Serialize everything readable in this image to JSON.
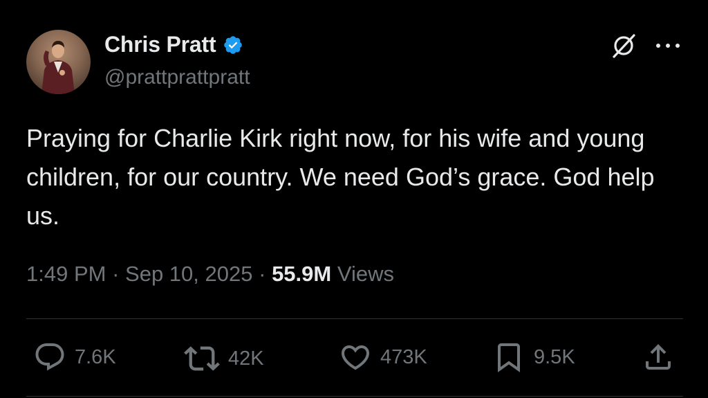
{
  "author": {
    "display_name": "Chris Pratt",
    "handle": "@prattprattpratt",
    "verified": true,
    "avatar_icon": "avatar"
  },
  "header_icons": {
    "grok": "grok-icon",
    "more": "more-icon"
  },
  "tweet": {
    "text": "Praying for Charlie Kirk right now, for his wife and young children, for our country. We need God’s grace. God help us.",
    "time": "1:49 PM",
    "separator": "·",
    "date": "Sep 10, 2025",
    "views_count": "55.9M",
    "views_label": "Views"
  },
  "actions": {
    "replies": "7.6K",
    "reposts": "42K",
    "likes": "473K",
    "bookmarks": "9.5K"
  },
  "colors": {
    "background": "#000000",
    "primary_text": "#e7e9ea",
    "secondary_text": "#71767b",
    "verified_blue": "#1d9bf0",
    "divider": "#2f3336"
  }
}
